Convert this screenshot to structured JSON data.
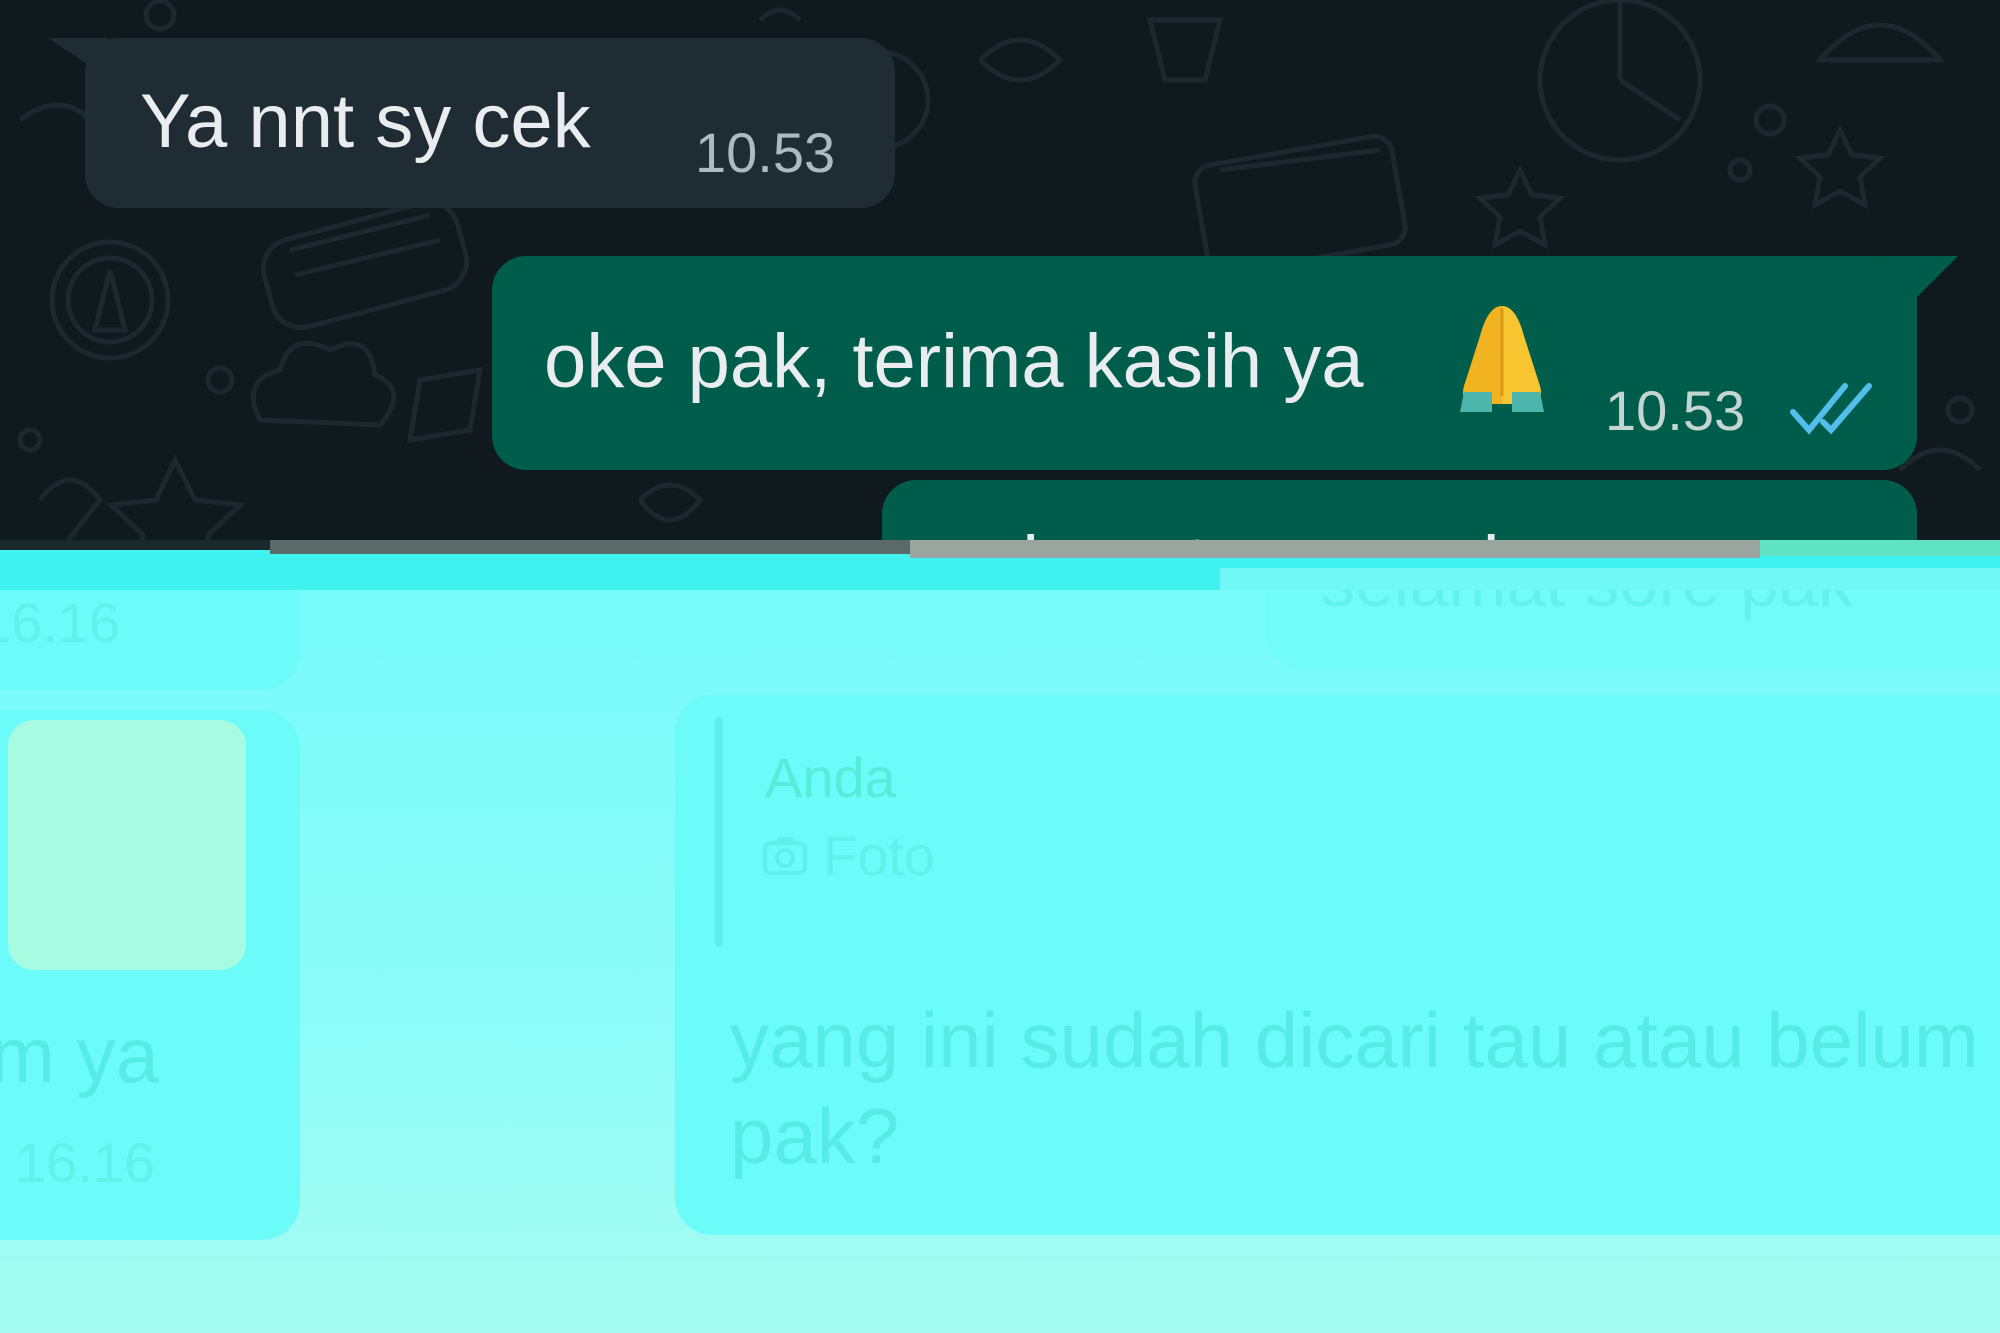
{
  "colors": {
    "chat_background": "#0f191e",
    "incoming_bubble": "#202c33",
    "outgoing_bubble": "#005c4b",
    "read_ticks": "#53bdeb",
    "glitch_cyan": "#77fbfb"
  },
  "messages": [
    {
      "direction": "incoming",
      "text": "Ya nnt sy cek",
      "time": "10.53"
    },
    {
      "direction": "outgoing",
      "text": "oke pak, terima kasih ya",
      "emoji": "folded-hands-emoji",
      "time": "10.53",
      "status": "read-double-tick-icon"
    },
    {
      "direction": "outgoing",
      "text": "selamat sore pak"
    }
  ],
  "faded_area": {
    "left_time_top": "16.16",
    "left_caption": "m ya",
    "left_time_bottom": "16.16",
    "right_top_text": "selamat sore pak",
    "reply_sender": "Anda",
    "reply_icon": "camera-icon",
    "reply_label": "Foto",
    "reply_text_line1": "yang ini sudah dicari tau atau belum",
    "reply_text_line2": "pak?"
  }
}
